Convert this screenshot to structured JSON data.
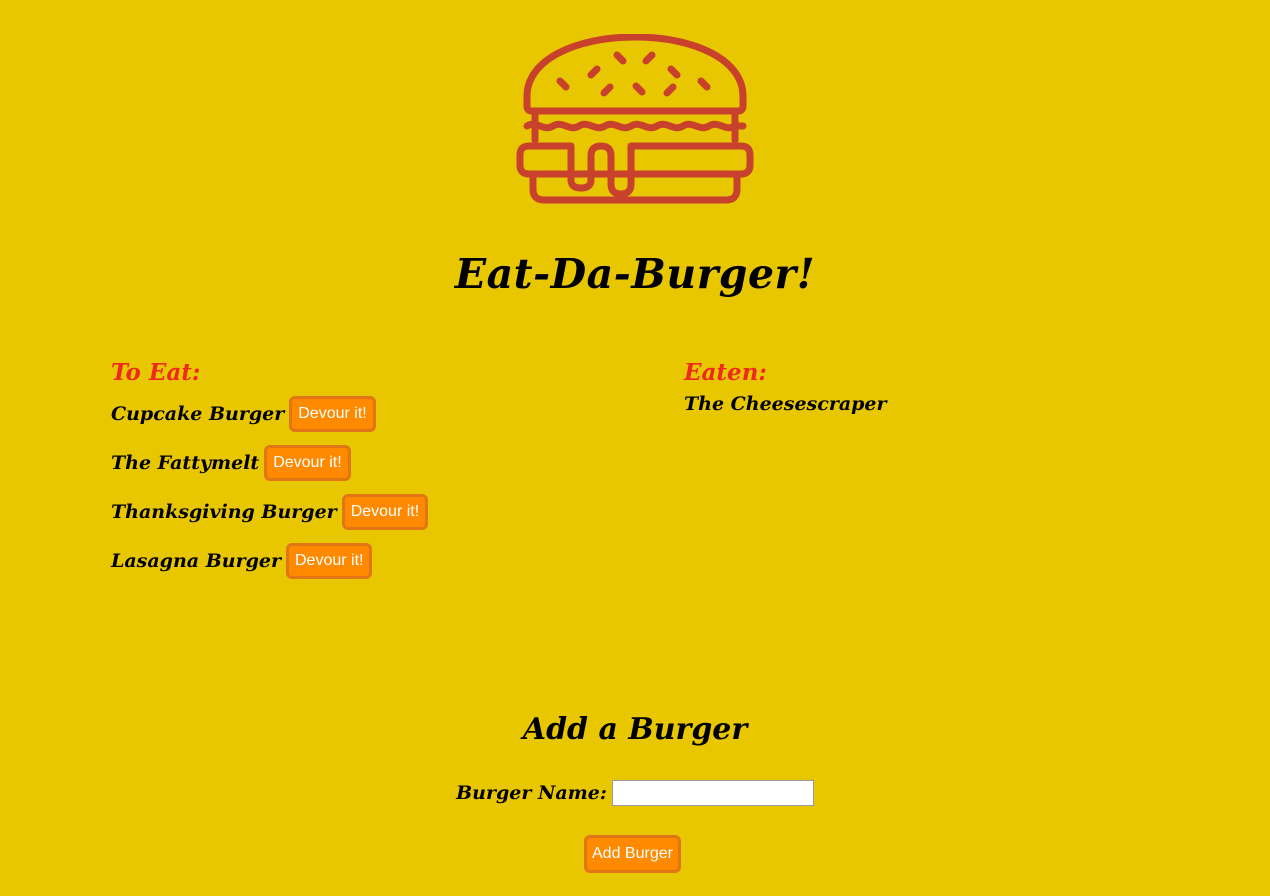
{
  "app": {
    "title": "Eat-Da-Burger!"
  },
  "colors": {
    "background": "#e9c700",
    "heading_accent": "#ee2a1e",
    "button_fill": "#ff8a00",
    "button_border": "#e07616",
    "logo_stroke": "#c8412c"
  },
  "logo": {
    "icon": "burger-icon"
  },
  "to_eat": {
    "heading": "To Eat:",
    "items": [
      {
        "name": "Cupcake Burger",
        "button_label": "Devour it!"
      },
      {
        "name": "The Fattymelt",
        "button_label": "Devour it!"
      },
      {
        "name": "Thanksgiving Burger",
        "button_label": "Devour it!"
      },
      {
        "name": "Lasagna Burger",
        "button_label": "Devour it!"
      }
    ]
  },
  "eaten": {
    "heading": "Eaten:",
    "items": [
      {
        "name": "The Cheesescraper"
      }
    ]
  },
  "add_form": {
    "title": "Add a Burger",
    "name_label": "Burger Name:",
    "name_value": "",
    "submit_label": "Add Burger"
  }
}
